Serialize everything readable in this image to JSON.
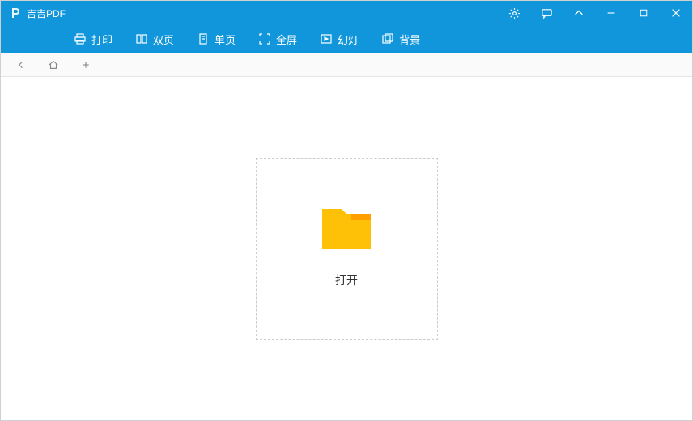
{
  "app": {
    "title": "吉吉PDF"
  },
  "toolbar": {
    "print": "打印",
    "double_page": "双页",
    "single_page": "单页",
    "fullscreen": "全屏",
    "slideshow": "幻灯",
    "background": "背景"
  },
  "main": {
    "open_label": "打开"
  }
}
